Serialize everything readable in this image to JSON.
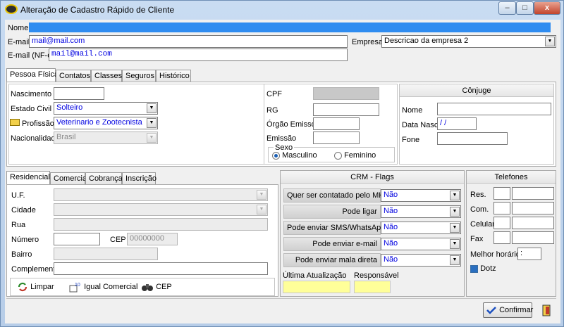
{
  "window": {
    "title": "Alteração de Cadastro Rápido de Cliente",
    "minimize": "–",
    "maximize": "□",
    "close": "x"
  },
  "header": {
    "nome_label": "Nome",
    "nome_value": "",
    "email_label": "E-mail",
    "email_value": "mail@mail.com",
    "email_nfe_label": "E-mail (NF-e)",
    "email_nfe_value": "mail@mail.com",
    "empresa_label": "Empresa",
    "empresa_value": "Descricao da empresa 2"
  },
  "main_tabs": [
    "Pessoa Física",
    "Contatos",
    "Classes",
    "Seguros",
    "Histórico"
  ],
  "pessoa": {
    "nascimento_label": "Nascimento",
    "nascimento_value": "",
    "estado_civil_label": "Estado Civil",
    "estado_civil_value": "Solteiro",
    "profissao_label": "Profissão",
    "profissao_value": "Veterinario e Zootecnista",
    "nacionalidade_label": "Nacionalidade",
    "nacionalidade_value": "Brasil",
    "cpf_label": "CPF",
    "rg_label": "RG",
    "orgao_label": "Órgão Emissor",
    "emissao_label": "Emissão",
    "sexo_label": "Sexo",
    "masculino": "Masculino",
    "feminino": "Feminino"
  },
  "conjuge": {
    "title": "Cônjuge",
    "nome_label": "Nome",
    "data_nasc_label": "Data Nasc.",
    "data_nasc_value": " / /",
    "fone_label": "Fone"
  },
  "addr_tabs": [
    "Residencial",
    "Comercial",
    "Cobrança",
    "Inscrição"
  ],
  "endereco": {
    "uf_label": "U.F.",
    "cidade_label": "Cidade",
    "rua_label": "Rua",
    "numero_label": "Número",
    "cep_label": "CEP",
    "cep_value": "00000000",
    "bairro_label": "Bairro",
    "complemento_label": "Complemento",
    "limpar": "Limpar",
    "igual_comercial": "Igual Comercial",
    "cep_button": "CEP"
  },
  "crm": {
    "title": "CRM - Flags",
    "rows": [
      {
        "label": "Quer ser contatado pelo MKT",
        "value": "Não"
      },
      {
        "label": "Pode ligar",
        "value": "Não"
      },
      {
        "label": "Pode enviar SMS/WhatsApp",
        "value": "Não"
      },
      {
        "label": "Pode enviar e-mail",
        "value": "Não"
      },
      {
        "label": "Pode enviar mala direta",
        "value": "Não"
      }
    ],
    "ultima_label": "Última Atualização",
    "responsavel_label": "Responsável"
  },
  "telefones": {
    "title": "Telefones",
    "res": "Res.",
    "com": "Com.",
    "celular": "Celular",
    "fax": "Fax",
    "melhor_horario_label": "Melhor horário",
    "melhor_horario_value": ":",
    "dotz_label": "Dotz"
  },
  "footer": {
    "confirmar": "Confirmar"
  }
}
